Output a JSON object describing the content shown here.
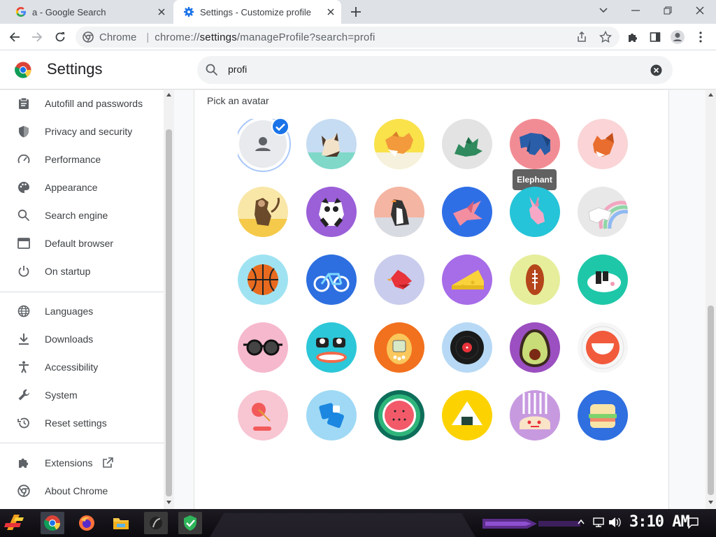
{
  "tabs": [
    {
      "title": "a - Google Search",
      "icon": "google-g-icon"
    },
    {
      "title": "Settings - Customize profile",
      "icon": "settings-gear-icon",
      "active": true
    }
  ],
  "toolbar": {
    "site_label": "Chrome",
    "url_path": "chrome://",
    "url_host": "settings",
    "url_rest": "/manageProfile?search=profi"
  },
  "settings": {
    "title": "Settings",
    "search_value": "profi"
  },
  "sidebar": {
    "items": [
      {
        "label": "Autofill and passwords",
        "icon": "clipboard-icon"
      },
      {
        "label": "Privacy and security",
        "icon": "shield-icon"
      },
      {
        "label": "Performance",
        "icon": "speedometer-icon"
      },
      {
        "label": "Appearance",
        "icon": "palette-icon"
      },
      {
        "label": "Search engine",
        "icon": "search-icon"
      },
      {
        "label": "Default browser",
        "icon": "browser-window-icon"
      },
      {
        "label": "On startup",
        "icon": "power-icon"
      },
      {
        "label": "Languages",
        "icon": "globe-icon"
      },
      {
        "label": "Downloads",
        "icon": "download-icon"
      },
      {
        "label": "Accessibility",
        "icon": "accessibility-icon"
      },
      {
        "label": "System",
        "icon": "wrench-icon"
      },
      {
        "label": "Reset settings",
        "icon": "history-icon"
      },
      {
        "label": "Extensions",
        "icon": "puzzle-icon"
      },
      {
        "label": "About Chrome",
        "icon": "chrome-logo-icon"
      }
    ]
  },
  "content": {
    "section_label": "Pick an avatar",
    "tooltip": "Elephant",
    "selected_avatar": "generic-person-avatar"
  },
  "taskbar": {
    "clock": "3:10 AM",
    "icons": [
      "start-icon",
      "chrome-icon",
      "firefox-icon",
      "file-explorer-icon",
      "media-icon",
      "shield-app-icon"
    ]
  },
  "colors": {
    "accent": "#1a73e8",
    "tab_strip": "#dee1e6",
    "tooltip_bg": "#616161"
  }
}
